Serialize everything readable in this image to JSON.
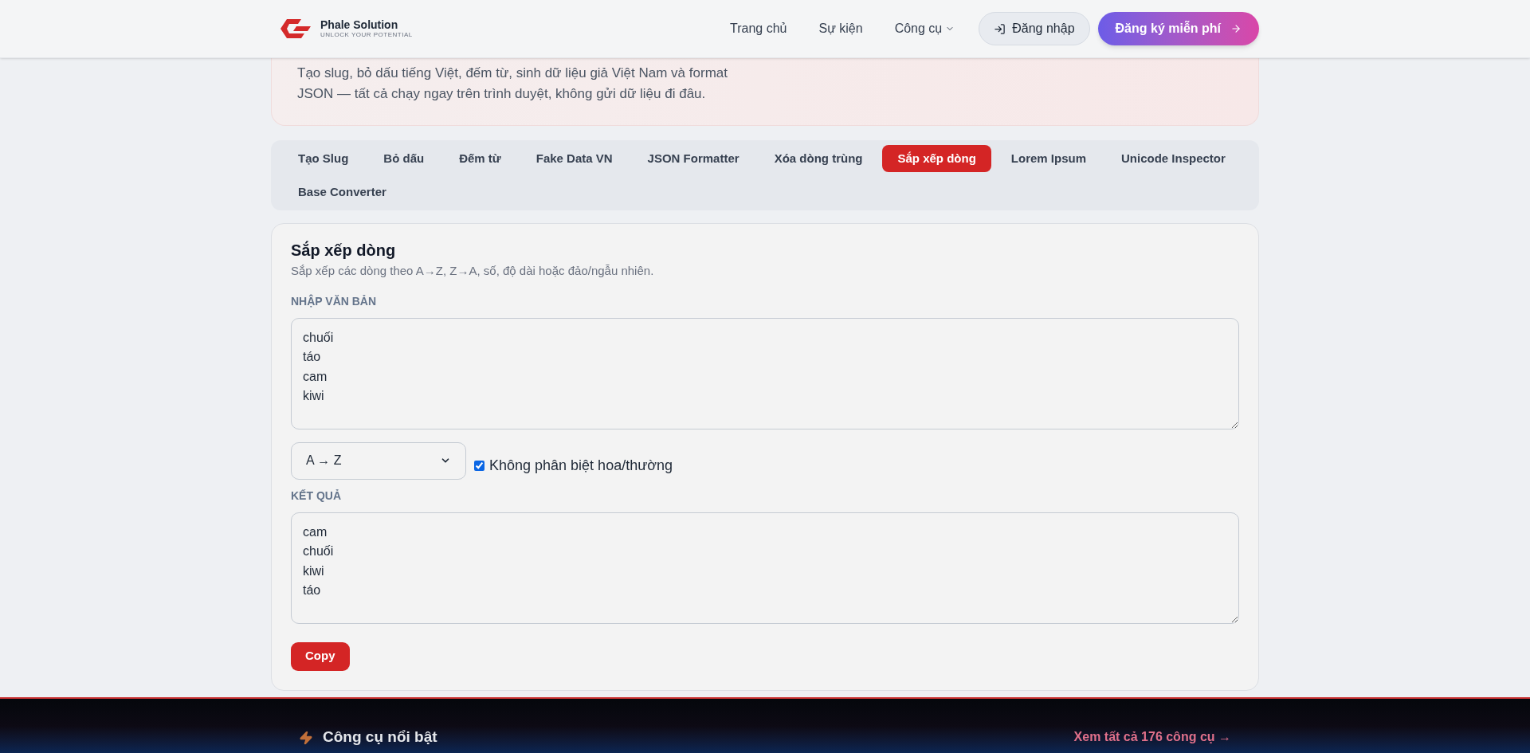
{
  "header": {
    "logo": {
      "name": "Phale Solution",
      "tagline": "UNLOCK YOUR POTENTIAL"
    },
    "nav": [
      {
        "label": "Trang chủ",
        "kind": "link"
      },
      {
        "label": "Sự kiện",
        "kind": "link"
      },
      {
        "label": "Công cụ",
        "kind": "dropdown"
      }
    ],
    "login": "Đăng nhập",
    "signup": "Đăng ký miễn phí"
  },
  "intro": {
    "lines": [
      "Tạo slug, bỏ dấu tiếng Việt, đếm từ, sinh dữ liệu giả Việt Nam và format",
      "JSON — tất cả chạy ngay trên trình duyệt, không gửi dữ liệu đi đâu."
    ]
  },
  "tabs": [
    {
      "label": "Tạo Slug",
      "selected": false
    },
    {
      "label": "Bỏ dấu",
      "selected": false
    },
    {
      "label": "Đếm từ",
      "selected": false
    },
    {
      "label": "Fake Data VN",
      "selected": false
    },
    {
      "label": "JSON Formatter",
      "selected": false
    },
    {
      "label": "Xóa dòng trùng",
      "selected": false
    },
    {
      "label": "Sắp xếp dòng",
      "selected": true
    },
    {
      "label": "Lorem Ipsum",
      "selected": false
    },
    {
      "label": "Unicode Inspector",
      "selected": false
    },
    {
      "label": "Base Converter",
      "selected": false
    }
  ],
  "tool": {
    "title": "Sắp xếp dòng",
    "subtitle": "Sắp xếp các dòng theo A→Z, Z→A, số, độ dài hoặc đảo/ngẫu nhiên.",
    "input_label": "NHẬP VĂN BẢN",
    "input_lines": [
      "chuối",
      "táo",
      "cam",
      "kiwi"
    ],
    "sort_order": "A → Z",
    "case_insensitive": {
      "label": "Không phân biệt hoa/thường",
      "checked": true
    },
    "output_label": "KẾT QUẢ",
    "output_lines": [
      "cam",
      "chuối",
      "kiwi",
      "táo"
    ],
    "copy_button": "Copy"
  },
  "footer": {
    "title": "Công cụ nổi bật",
    "link": "Xem tất cả 176 công cụ →"
  }
}
